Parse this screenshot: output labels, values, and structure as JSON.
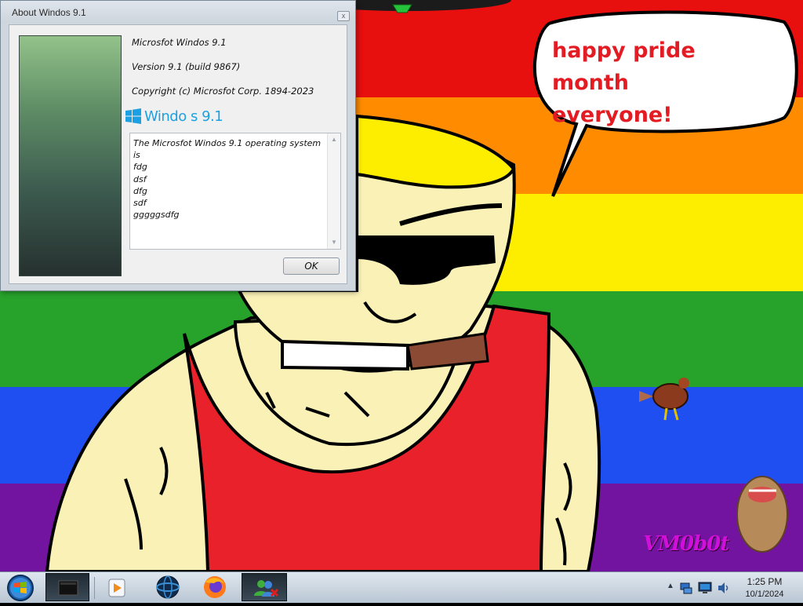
{
  "wallpaper": {
    "speech_bubble": [
      "happy pride month",
      "everyone!"
    ],
    "watermark": "VM0b0t",
    "stripe_colors": [
      "#e80f0f",
      "#ff8b00",
      "#fdee00",
      "#27a22b",
      "#1f4ff0",
      "#7314a0"
    ]
  },
  "dialog": {
    "title": "About Windos 9.1",
    "product_name": "Microsfot Windos 9.1",
    "version": "Version 9.1 (build 9867)",
    "copyright": "Copyright (c) Microsfot Corp. 1894-2023",
    "logo_wordmark": "Windo  s 9.1",
    "description_lines": [
      "The Microsfot Windos 9.1 operating system",
      "is",
      "fdg",
      "dsf",
      "dfg",
      "sdf",
      "gggggsdfg"
    ],
    "ok_label": "OK",
    "close_glyph": "x"
  },
  "taskbar": {
    "items": [
      {
        "name": "command-prompt",
        "icon": "terminal-icon",
        "active": true
      },
      {
        "name": "media-player",
        "icon": "media-player-icon",
        "active": false
      },
      {
        "name": "globe-browser",
        "icon": "globe-icon",
        "active": false
      },
      {
        "name": "firefox",
        "icon": "firefox-icon",
        "active": false
      },
      {
        "name": "messenger",
        "icon": "messenger-icon",
        "active": true
      }
    ],
    "tray": {
      "show_hidden": "▲",
      "icons": [
        "network-icon",
        "monitor-icon",
        "speaker-icon"
      ],
      "time": "1:25 PM",
      "date": "10/1/2024"
    }
  }
}
